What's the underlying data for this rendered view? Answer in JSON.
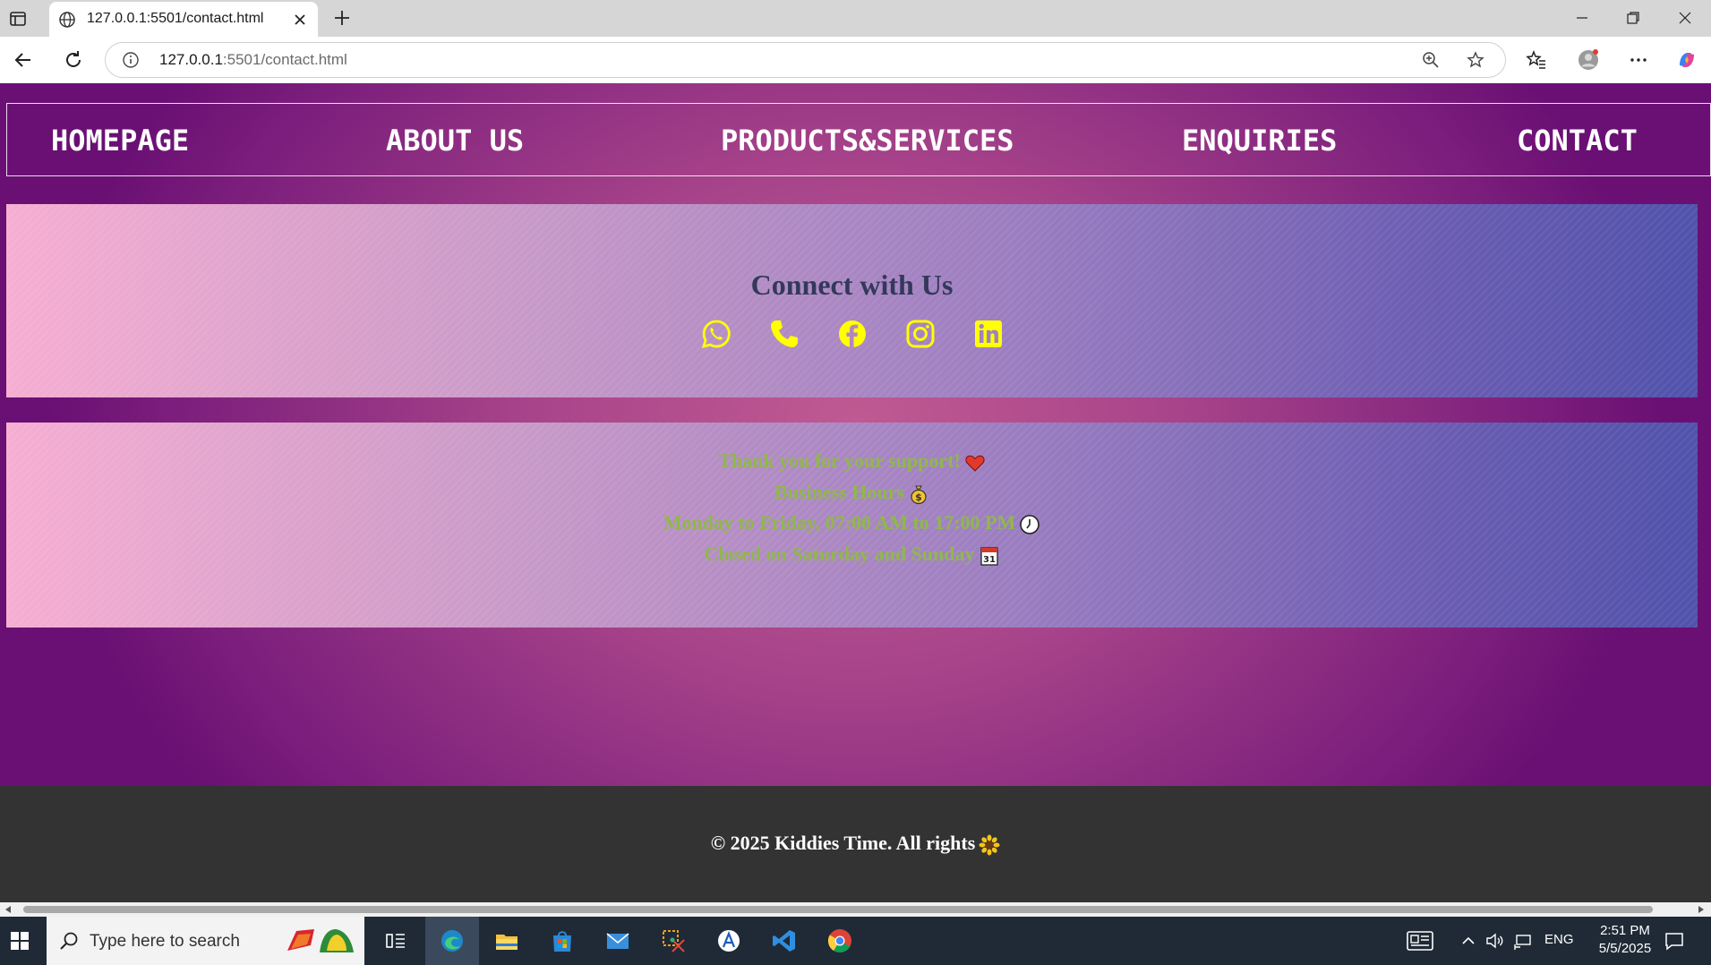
{
  "browser": {
    "tab_title": "127.0.0.1:5501/contact.html",
    "url_host": "127.0.0.1",
    "url_rest": ":5501/contact.html"
  },
  "nav": {
    "items": [
      "HOMEPAGE",
      "ABOUT US",
      "PRODUCTS&SERVICES",
      "ENQUIRIES",
      "CONTACT"
    ]
  },
  "connect": {
    "title": "Connect with Us",
    "icons": [
      "whatsapp-icon",
      "phone-icon",
      "facebook-icon",
      "instagram-icon",
      "linkedin-icon"
    ],
    "icon_color": "#ffff00"
  },
  "hours": {
    "line1": "Thank you for your support!",
    "line2": "Business Hours",
    "line3": "Monday to Friday, 07:00 AM to 17:00 PM",
    "line4": "Closed on Saturday and Sunday",
    "text_color": "#8fb84a"
  },
  "footer": {
    "text": "© 2025 Kiddies Time. All rights"
  },
  "taskbar": {
    "search_placeholder": "Type here to search",
    "language": "ENG",
    "time": "2:51 PM",
    "date": "5/5/2025"
  }
}
